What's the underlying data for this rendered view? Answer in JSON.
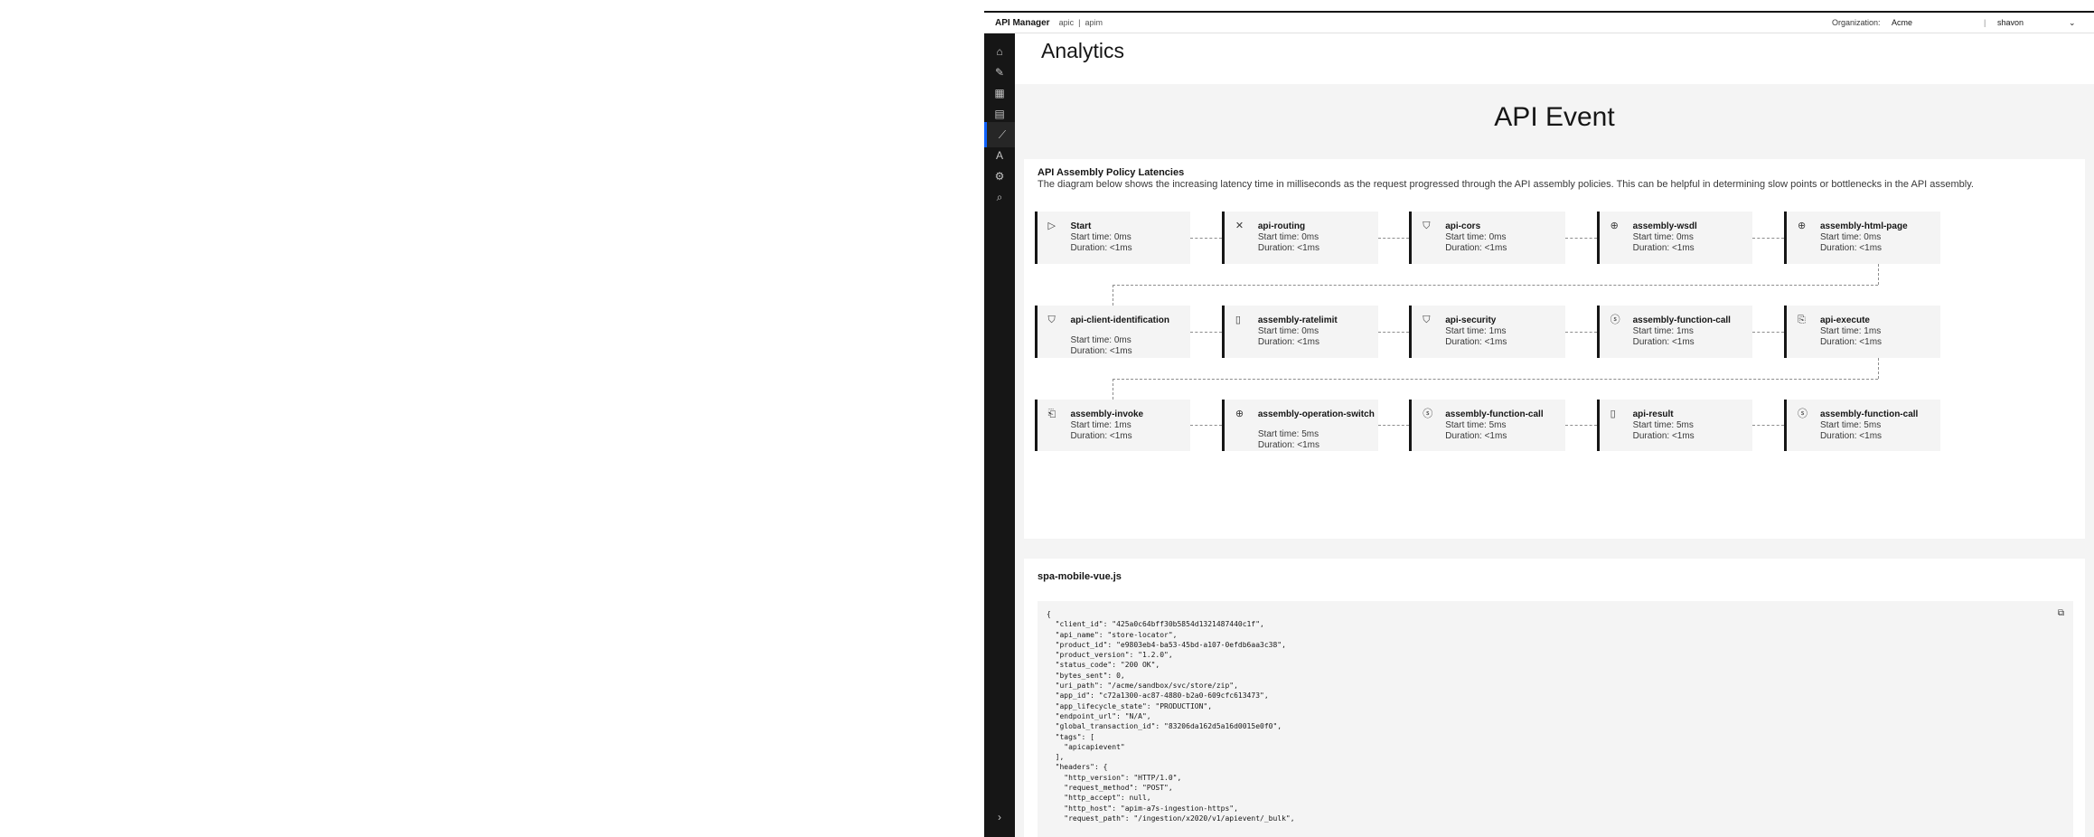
{
  "topbar": {
    "brand": "API Manager",
    "crumb_1": "apic",
    "crumb_sep": "|",
    "crumb_2": "apim",
    "org_label": "Organization:",
    "org_value": "Acme",
    "separator": "|",
    "user": "shavon",
    "chevron": "⌄"
  },
  "sidenav": {
    "items": [
      {
        "icon": "home-icon",
        "glyph": "⌂"
      },
      {
        "icon": "edit-icon",
        "glyph": "✎"
      },
      {
        "icon": "apps-icon",
        "glyph": "▦"
      },
      {
        "icon": "catalog-icon",
        "glyph": "▤"
      },
      {
        "icon": "analytics-icon",
        "glyph": "⟋"
      },
      {
        "icon": "translate-icon",
        "glyph": "A"
      },
      {
        "icon": "settings-icon",
        "glyph": "⚙"
      },
      {
        "icon": "search-icon",
        "glyph": "⌕"
      }
    ],
    "active_index": 4,
    "expand_glyph": "›"
  },
  "page": {
    "title": "Analytics"
  },
  "event": {
    "title": "API Event",
    "section_title": "API Assembly Policy Latencies",
    "section_desc": "The diagram below shows the increasing latency time in milliseconds as the request progressed through the API assembly policies. This can be helpful in determining slow points or bottlenecks in the API assembly.",
    "policies": [
      {
        "name": "Start",
        "start": "Start time: 0ms",
        "duration": "Duration: <1ms",
        "icon": "play-icon",
        "glyph": "▷"
      },
      {
        "name": "api-routing",
        "start": "Start time: 0ms",
        "duration": "Duration: <1ms",
        "icon": "routing-icon",
        "glyph": "✕"
      },
      {
        "name": "api-cors",
        "start": "Start time: 0ms",
        "duration": "Duration: <1ms",
        "icon": "shield-icon",
        "glyph": "⛉"
      },
      {
        "name": "assembly-wsdl",
        "start": "Start time: 0ms",
        "duration": "Duration: <1ms",
        "icon": "globe-icon",
        "glyph": "⊕"
      },
      {
        "name": "assembly-html-page",
        "start": "Start time: 0ms",
        "duration": "Duration: <1ms",
        "icon": "globe-icon",
        "glyph": "⊕"
      },
      {
        "name": "api-client-identification",
        "start": "Start time: 0ms",
        "duration": "Duration: <1ms",
        "icon": "shield-check-icon",
        "glyph": "⛉"
      },
      {
        "name": "assembly-ratelimit",
        "start": "Start time: 0ms",
        "duration": "Duration: <1ms",
        "icon": "document-icon",
        "glyph": "▯"
      },
      {
        "name": "api-security",
        "start": "Start time: 1ms",
        "duration": "Duration: <1ms",
        "icon": "shield-check-icon",
        "glyph": "⛉"
      },
      {
        "name": "assembly-function-call",
        "start": "Start time: 1ms",
        "duration": "Duration: <1ms",
        "icon": "function-icon",
        "glyph": "ⓢ"
      },
      {
        "name": "api-execute",
        "start": "Start time: 1ms",
        "duration": "Duration: <1ms",
        "icon": "execute-icon",
        "glyph": "⎘"
      },
      {
        "name": "assembly-invoke",
        "start": "Start time: 1ms",
        "duration": "Duration: <1ms",
        "icon": "invoke-icon",
        "glyph": "⎗"
      },
      {
        "name": "assembly-operation-switch",
        "start": "Start time: 5ms",
        "duration": "Duration: <1ms",
        "icon": "globe-icon",
        "glyph": "⊕"
      },
      {
        "name": "assembly-function-call",
        "start": "Start time: 5ms",
        "duration": "Duration: <1ms",
        "icon": "function-icon",
        "glyph": "ⓢ"
      },
      {
        "name": "api-result",
        "start": "Start time: 5ms",
        "duration": "Duration: <1ms",
        "icon": "clipboard-icon",
        "glyph": "▯"
      },
      {
        "name": "assembly-function-call",
        "start": "Start time: 5ms",
        "duration": "Duration: <1ms",
        "icon": "function-icon",
        "glyph": "ⓢ"
      }
    ]
  },
  "json_panel": {
    "title": "spa-mobile-vue.js",
    "copy_glyph": "⧉",
    "code": "{\n  \"client_id\": \"425a0c64bff30b5854d1321487440c1f\",\n  \"api_name\": \"store-locator\",\n  \"product_id\": \"e9803eb4-ba53-45bd-a107-0efdb6aa3c38\",\n  \"product_version\": \"1.2.0\",\n  \"status_code\": \"200 OK\",\n  \"bytes_sent\": 0,\n  \"uri_path\": \"/acme/sandbox/svc/store/zip\",\n  \"app_id\": \"c72a1300-ac87-4880-b2a0-609cfc613473\",\n  \"app_lifecycle_state\": \"PRODUCTION\",\n  \"endpoint_url\": \"N/A\",\n  \"global_transaction_id\": \"83206da162d5a16d0015e0f0\",\n  \"tags\": [\n    \"apicapievent\"\n  ],\n  \"headers\": {\n    \"http_version\": \"HTTP/1.0\",\n    \"request_method\": \"POST\",\n    \"http_accept\": null,\n    \"http_host\": \"apim-a7s-ingestion-https\",\n    \"request_path\": \"/ingestion/x2020/v1/apievent/_bulk\","
  }
}
